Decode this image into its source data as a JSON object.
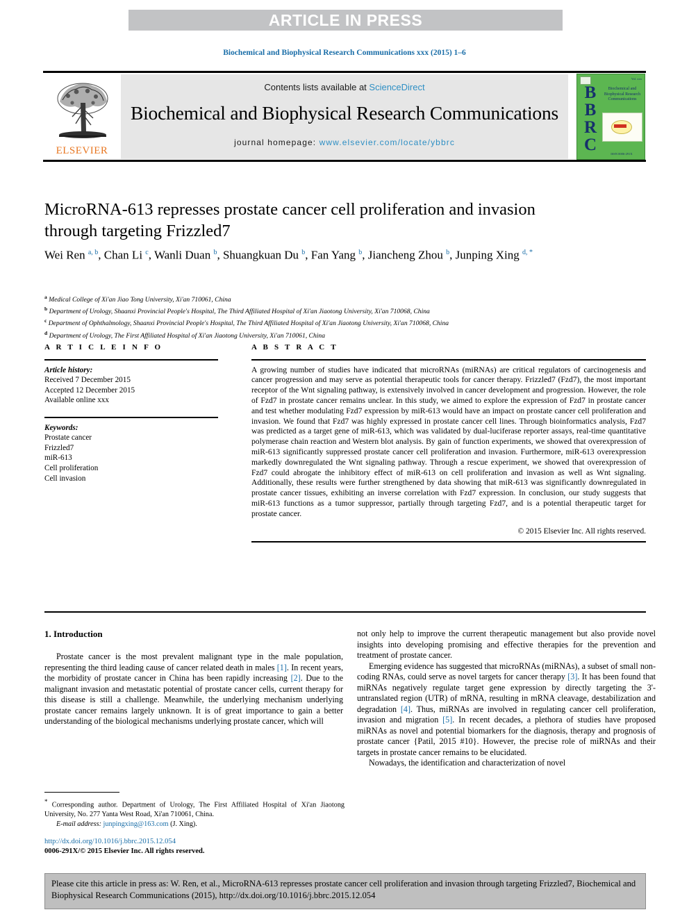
{
  "banner": {
    "text": "ARTICLE IN PRESS"
  },
  "journal_ref": "Biochemical and Biophysical Research Communications xxx (2015) 1–6",
  "masthead": {
    "contents_prefix": "Contents lists available at ",
    "sciencedirect": "ScienceDirect",
    "journal_title": "Biochemical and Biophysical Research Communications",
    "homepage_label": "journal homepage: ",
    "homepage_url": "www.elsevier.com/locate/ybbrc",
    "elsevier_word": "ELSEVIER",
    "bbrc_letters": "BBRC",
    "bbrc_cover_title": "Biochemical and Biophysical Research Communications",
    "bbrc_issn": "ISSN 0006-291X",
    "bbrc_topcode": "Vol. xxx",
    "colors": {
      "banner_bg": "#c2c3c5",
      "link_blue": "#2e8fc4",
      "ref_blue": "#1a6ea8",
      "elsevier_orange": "#e87722",
      "cover_green": "#5cb651",
      "cover_navy": "#16306b",
      "band_gray": "#e6e6e6",
      "cite_gray": "#bfbfbf"
    }
  },
  "article": {
    "title": "MicroRNA-613 represses prostate cancer cell proliferation and invasion through targeting Frizzled7",
    "authors": [
      {
        "name": "Wei Ren",
        "marks": "a, b"
      },
      {
        "name": "Chan Li",
        "marks": "c"
      },
      {
        "name": "Wanli Duan",
        "marks": "b"
      },
      {
        "name": "Shuangkuan Du",
        "marks": "b"
      },
      {
        "name": "Fan Yang",
        "marks": "b"
      },
      {
        "name": "Jiancheng Zhou",
        "marks": "b"
      },
      {
        "name": "Junping Xing",
        "marks": "d, *"
      }
    ],
    "affiliations": [
      {
        "mark": "a",
        "text": "Medical College of Xi'an Jiao Tong University, Xi'an 710061, China"
      },
      {
        "mark": "b",
        "text": "Department of Urology, Shaanxi Provincial People's Hospital, The Third Affiliated Hospital of Xi'an Jiaotong University, Xi'an 710068, China"
      },
      {
        "mark": "c",
        "text": "Department of Ophthalmology, Shaanxi Provincial People's Hospital, The Third Affiliated Hospital of Xi'an Jiaotong University, Xi'an 710068, China"
      },
      {
        "mark": "d",
        "text": "Department of Urology, The First Affiliated Hospital of Xi'an Jiaotong University, Xi'an 710061, China"
      }
    ]
  },
  "article_info": {
    "heading": "A R T I C L E   I N F O",
    "history_label": "Article history:",
    "history": [
      "Received 7 December 2015",
      "Accepted 12 December 2015",
      "Available online xxx"
    ],
    "keywords_label": "Keywords:",
    "keywords": [
      "Prostate cancer",
      "Frizzled7",
      "miR-613",
      "Cell proliferation",
      "Cell invasion"
    ]
  },
  "abstract": {
    "heading": "A B S T R A C T",
    "text": "A growing number of studies have indicated that microRNAs (miRNAs) are critical regulators of carcinogenesis and cancer progression and may serve as potential therapeutic tools for cancer therapy. Frizzled7 (Fzd7), the most important receptor of the Wnt signaling pathway, is extensively involved in cancer development and progression. However, the role of Fzd7 in prostate cancer remains unclear. In this study, we aimed to explore the expression of Fzd7 in prostate cancer and test whether modulating Fzd7 expression by miR-613 would have an impact on prostate cancer cell proliferation and invasion. We found that Fzd7 was highly expressed in prostate cancer cell lines. Through bioinformatics analysis, Fzd7 was predicted as a target gene of miR-613, which was validated by dual-luciferase reporter assays, real-time quantitative polymerase chain reaction and Western blot analysis. By gain of function experiments, we showed that overexpression of miR-613 significantly suppressed prostate cancer cell proliferation and invasion. Furthermore, miR-613 overexpression markedly downregulated the Wnt signaling pathway. Through a rescue experiment, we showed that overexpression of Fzd7 could abrogate the inhibitory effect of miR-613 on cell proliferation and invasion as well as Wnt signaling. Additionally, these results were further strengthened by data showing that miR-613 was significantly downregulated in prostate cancer tissues, exhibiting an inverse correlation with Fzd7 expression. In conclusion, our study suggests that miR-613 functions as a tumor suppressor, partially through targeting Fzd7, and is a potential therapeutic target for prostate cancer.",
    "copyright": "© 2015 Elsevier Inc. All rights reserved."
  },
  "body": {
    "section_title": "1.  Introduction",
    "left_paragraphs": [
      {
        "parts": [
          {
            "t": "Prostate cancer is the most prevalent malignant type in the male population, representing the third leading cause of cancer related death in males "
          },
          {
            "t": "[1]",
            "ref": true
          },
          {
            "t": ". In recent years, the morbidity of prostate cancer in China has been rapidly increasing "
          },
          {
            "t": "[2]",
            "ref": true
          },
          {
            "t": ". Due to the malignant invasion and metastatic potential of prostate cancer cells, current therapy for this disease is still a challenge. Meanwhile, the underlying mechanism underlying prostate cancer remains largely unknown. It is of great importance to gain a better understanding of the biological mechanisms underlying prostate cancer, which will"
          }
        ]
      }
    ],
    "right_paragraphs": [
      {
        "indent": false,
        "parts": [
          {
            "t": "not only help to improve the current therapeutic management but also provide novel insights into developing promising and effective therapies for the prevention and treatment of prostate cancer."
          }
        ]
      },
      {
        "indent": true,
        "parts": [
          {
            "t": "Emerging evidence has suggested that microRNAs (miRNAs), a subset of small non-coding RNAs, could serve as novel targets for cancer therapy "
          },
          {
            "t": "[3]",
            "ref": true
          },
          {
            "t": ". It has been found that miRNAs negatively regulate target gene expression by directly targeting the 3'-untranslated region (UTR) of mRNA, resulting in mRNA cleavage, destabilization and degradation "
          },
          {
            "t": "[4]",
            "ref": true
          },
          {
            "t": ". Thus, miRNAs are involved in regulating cancer cell proliferation, invasion and migration "
          },
          {
            "t": "[5]",
            "ref": true
          },
          {
            "t": ". In recent decades, a plethora of studies have proposed miRNAs as novel and potential biomarkers for the diagnosis, therapy and prognosis of prostate cancer {Patil, 2015 #10}. However, the precise role of miRNAs and their targets in prostate cancer remains to be elucidated."
          }
        ]
      },
      {
        "indent": true,
        "parts": [
          {
            "t": "Nowadays, the identification and characterization of novel"
          }
        ]
      }
    ]
  },
  "footnote": {
    "star": "*",
    "text": "Corresponding author. Department of Urology, The First Affiliated Hospital of Xi'an Jiaotong University, No. 277 Yanta West Road, Xi'an 710061, China.",
    "email_label": "E-mail address: ",
    "email": "junpingxing@163.com",
    "email_owner": "(J. Xing)."
  },
  "doi_block": {
    "doi_url": "http://dx.doi.org/10.1016/j.bbrc.2015.12.054",
    "issn_line": "0006-291X/© 2015 Elsevier Inc. All rights reserved."
  },
  "cite_box": {
    "text": "Please cite this article in press as: W. Ren, et al., MicroRNA-613 represses prostate cancer cell proliferation and invasion through targeting Frizzled7, Biochemical and Biophysical Research Communications (2015), http://dx.doi.org/10.1016/j.bbrc.2015.12.054"
  }
}
